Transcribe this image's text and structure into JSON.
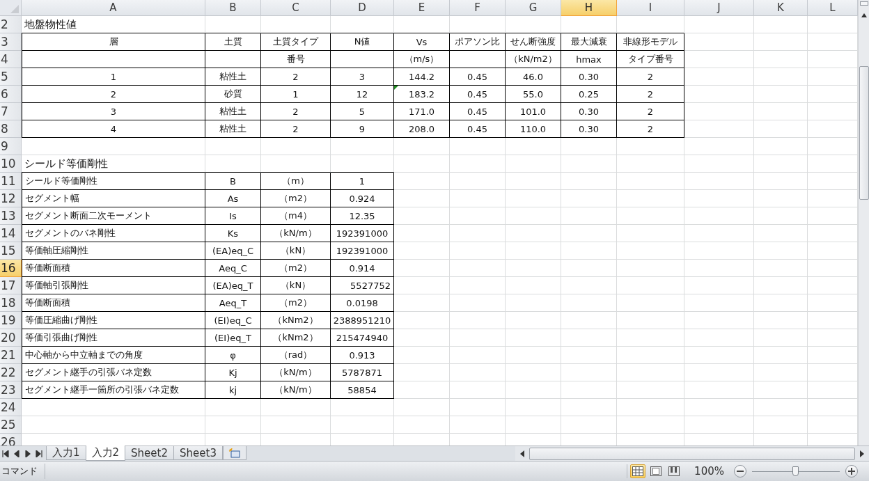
{
  "sheet": {
    "columns": [
      {
        "label": "A",
        "selected": false
      },
      {
        "label": "B",
        "selected": false
      },
      {
        "label": "C",
        "selected": false
      },
      {
        "label": "D",
        "selected": false
      },
      {
        "label": "E",
        "selected": false
      },
      {
        "label": "F",
        "selected": false
      },
      {
        "label": "G",
        "selected": false
      },
      {
        "label": "H",
        "selected": true
      },
      {
        "label": "I",
        "selected": false
      },
      {
        "label": "J",
        "selected": false
      },
      {
        "label": "K",
        "selected": false
      },
      {
        "label": "L",
        "selected": false
      }
    ],
    "rows": [
      {
        "number": "2",
        "selected": false,
        "kind": "title",
        "cells": [
          {
            "text": "地盤物性値"
          }
        ]
      },
      {
        "number": "3",
        "selected": false,
        "kind": "header",
        "cells": [
          {
            "text": "層"
          },
          {
            "text": "土質"
          },
          {
            "text": "土質タイプ"
          },
          {
            "text": "N値"
          },
          {
            "text": "Vs"
          },
          {
            "text": "ポアソン比"
          },
          {
            "text": "せん断強度"
          },
          {
            "text": "最大減衰"
          },
          {
            "text": "非線形モデル"
          }
        ]
      },
      {
        "number": "4",
        "selected": false,
        "kind": "subheader",
        "cells": [
          {},
          {},
          {
            "text": "番号"
          },
          {},
          {
            "text": "（m/s）"
          },
          {},
          {
            "text": "（kN/m2）"
          },
          {
            "text": "hmax"
          },
          {
            "text": "タイプ番号"
          }
        ]
      },
      {
        "number": "5",
        "selected": false,
        "kind": "layer",
        "cells": [
          {
            "text": "1"
          },
          {
            "text": "粘性土"
          },
          {
            "text": "2"
          },
          {
            "text": "3"
          },
          {
            "text": "144.2"
          },
          {
            "text": "0.45"
          },
          {
            "text": "46.0"
          },
          {
            "text": "0.30"
          },
          {
            "text": "2"
          }
        ]
      },
      {
        "number": "6",
        "selected": false,
        "kind": "layer",
        "cells": [
          {
            "text": "2"
          },
          {
            "text": "砂質"
          },
          {
            "text": "1"
          },
          {
            "text": "12"
          },
          {
            "text": "183.2",
            "warning": true
          },
          {
            "text": "0.45"
          },
          {
            "text": "55.0"
          },
          {
            "text": "0.25"
          },
          {
            "text": "2"
          }
        ]
      },
      {
        "number": "7",
        "selected": false,
        "kind": "layer",
        "cells": [
          {
            "text": "3"
          },
          {
            "text": "粘性土"
          },
          {
            "text": "2"
          },
          {
            "text": "5"
          },
          {
            "text": "171.0"
          },
          {
            "text": "0.45"
          },
          {
            "text": "101.0"
          },
          {
            "text": "0.30"
          },
          {
            "text": "2"
          }
        ]
      },
      {
        "number": "8",
        "selected": false,
        "kind": "layer",
        "cells": [
          {
            "text": "4"
          },
          {
            "text": "粘性土"
          },
          {
            "text": "2"
          },
          {
            "text": "9"
          },
          {
            "text": "208.0"
          },
          {
            "text": "0.45"
          },
          {
            "text": "110.0"
          },
          {
            "text": "0.30"
          },
          {
            "text": "2"
          }
        ]
      },
      {
        "number": "9",
        "selected": false,
        "kind": "blank",
        "cells": []
      },
      {
        "number": "10",
        "selected": false,
        "kind": "title",
        "cells": [
          {
            "text": "シールド等価剛性"
          }
        ]
      },
      {
        "number": "11",
        "selected": false,
        "kind": "param",
        "cells": [
          {
            "text": "シールド等価剛性"
          },
          {
            "text": "B"
          },
          {
            "text": "（m）"
          },
          {
            "text": "1"
          }
        ]
      },
      {
        "number": "12",
        "selected": false,
        "kind": "param",
        "cells": [
          {
            "text": "セグメント幅"
          },
          {
            "text": "As"
          },
          {
            "text": "（m2）"
          },
          {
            "text": "0.924"
          }
        ]
      },
      {
        "number": "13",
        "selected": false,
        "kind": "param",
        "cells": [
          {
            "text": "セグメント断面二次モーメント"
          },
          {
            "text": "Is"
          },
          {
            "text": "（m4）"
          },
          {
            "text": "12.35"
          }
        ]
      },
      {
        "number": "14",
        "selected": false,
        "kind": "param",
        "cells": [
          {
            "text": "セグメントのバネ剛性"
          },
          {
            "text": "Ks"
          },
          {
            "text": "（kN/m）"
          },
          {
            "text": "192391000"
          }
        ]
      },
      {
        "number": "15",
        "selected": false,
        "kind": "param",
        "cells": [
          {
            "text": "等価軸圧縮剛性"
          },
          {
            "text": "(EA)eq_C"
          },
          {
            "text": "（kN）"
          },
          {
            "text": "192391000"
          }
        ]
      },
      {
        "number": "16",
        "selected": true,
        "kind": "param",
        "cells": [
          {
            "text": "等価断面積"
          },
          {
            "text": "Aeq_C"
          },
          {
            "text": "（m2）"
          },
          {
            "text": "0.914"
          }
        ]
      },
      {
        "number": "17",
        "selected": false,
        "kind": "param",
        "cells": [
          {
            "text": "等価軸引張剛性"
          },
          {
            "text": "(EA)eq_T"
          },
          {
            "text": "（kN）"
          },
          {
            "text": "5527752",
            "right_aligned": true
          }
        ]
      },
      {
        "number": "18",
        "selected": false,
        "kind": "param",
        "cells": [
          {
            "text": "等価断面積"
          },
          {
            "text": "Aeq_T"
          },
          {
            "text": "（m2）"
          },
          {
            "text": "0.0198"
          }
        ]
      },
      {
        "number": "19",
        "selected": false,
        "kind": "param",
        "cells": [
          {
            "text": "等価圧縮曲げ剛性"
          },
          {
            "text": "(EI)eq_C"
          },
          {
            "text": "（kNm2）"
          },
          {
            "text": "2388951210"
          }
        ]
      },
      {
        "number": "20",
        "selected": false,
        "kind": "param",
        "cells": [
          {
            "text": "等価引張曲げ剛性"
          },
          {
            "text": "(EI)eq_T"
          },
          {
            "text": "（kNm2）"
          },
          {
            "text": "215474940"
          }
        ]
      },
      {
        "number": "21",
        "selected": false,
        "kind": "param",
        "cells": [
          {
            "text": "中心軸から中立軸までの角度"
          },
          {
            "text": "φ"
          },
          {
            "text": "（rad）"
          },
          {
            "text": "0.913"
          }
        ]
      },
      {
        "number": "22",
        "selected": false,
        "kind": "param",
        "cells": [
          {
            "text": "セグメント継手の引張バネ定数"
          },
          {
            "text": "Kj"
          },
          {
            "text": "（kN/m）"
          },
          {
            "text": "5787871"
          }
        ]
      },
      {
        "number": "23",
        "selected": false,
        "kind": "param",
        "cells": [
          {
            "text": "セグメント継手一箇所の引張バネ定数"
          },
          {
            "text": "kj"
          },
          {
            "text": "（kN/m）"
          },
          {
            "text": "58854"
          }
        ]
      },
      {
        "number": "24",
        "selected": false,
        "kind": "blank",
        "cells": []
      },
      {
        "number": "25",
        "selected": false,
        "kind": "blank",
        "cells": []
      },
      {
        "number": "26",
        "selected": false,
        "kind": "blank",
        "cells": []
      }
    ]
  },
  "sheet_tabs": [
    {
      "label": "入力1",
      "selected": false
    },
    {
      "label": "入力2",
      "selected": true
    },
    {
      "label": "Sheet2",
      "selected": false
    },
    {
      "label": "Sheet3",
      "selected": false
    }
  ],
  "status_bar": {
    "mode": "コマンド",
    "views": [
      {
        "kind": "normal",
        "selected": true
      },
      {
        "kind": "page_layout",
        "selected": false
      },
      {
        "kind": "page_break",
        "selected": false
      }
    ],
    "zoom": "100%",
    "zoom_slider": {
      "level": 0.5
    }
  }
}
